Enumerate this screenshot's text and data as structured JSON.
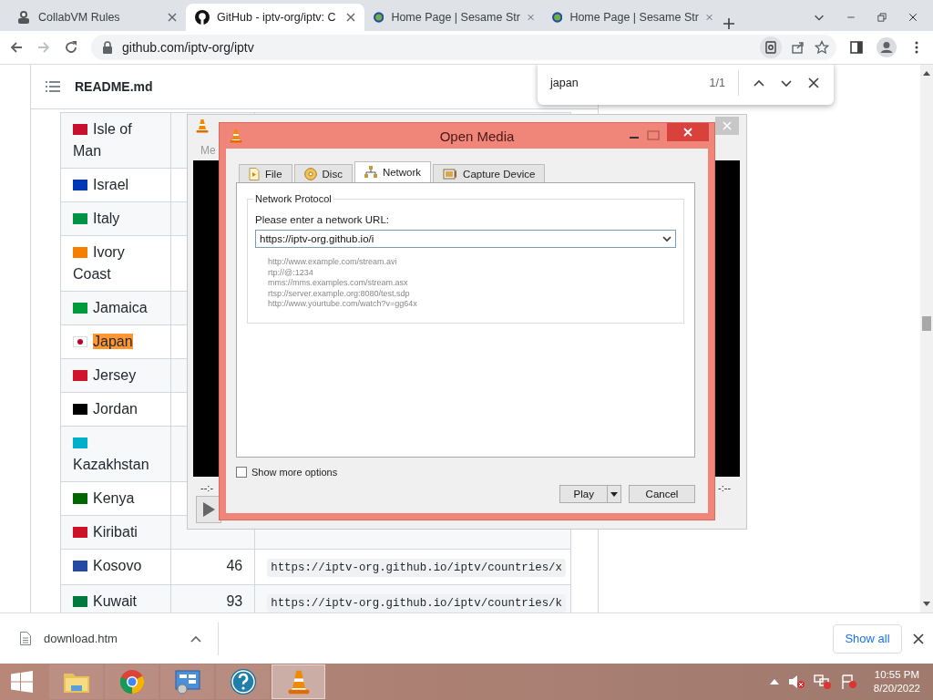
{
  "browser": {
    "tabs": [
      {
        "kind": "collabvm",
        "title": "CollabVM Rules",
        "selected": false
      },
      {
        "kind": "github",
        "title": "GitHub - iptv-org/iptv: C",
        "selected": true
      },
      {
        "kind": "pbs",
        "title": "Home Page | Sesame Str",
        "selected": false
      },
      {
        "kind": "pbs",
        "title": "Home Page | Sesame Str",
        "selected": false
      }
    ],
    "address": "github.com/iptv-org/iptv"
  },
  "find_bar": {
    "query": "japan",
    "count": "1/1"
  },
  "page": {
    "file_title": "README.md",
    "rows": [
      {
        "country": "Isle of Man",
        "color": "#c8102e",
        "match": false
      },
      {
        "country": "Israel",
        "color": "#0038b8",
        "match": false
      },
      {
        "country": "Italy",
        "color": "#009246",
        "match": false
      },
      {
        "country": "Ivory Coast",
        "color": "#f77f00",
        "match": false
      },
      {
        "country": "Jamaica",
        "color": "#009b3a",
        "match": false
      },
      {
        "country": "Japan",
        "color": "#bc002d",
        "match": true
      },
      {
        "country": "Jersey",
        "color": "#cf142b",
        "match": false
      },
      {
        "country": "Jordan",
        "color": "#000000",
        "match": false
      },
      {
        "country": "Kazakhstan",
        "color": "#00afca",
        "match": false
      },
      {
        "country": "Kenya",
        "color": "#006600",
        "match": false
      },
      {
        "country": "Kiribati",
        "color": "#ce1126",
        "match": false
      },
      {
        "country": "Kosovo",
        "color": "#244aa5",
        "match": false,
        "number": "46",
        "url": "https://iptv-org.github.io/iptv/countries/x"
      },
      {
        "country": "Kuwait",
        "color": "#007a3d",
        "match": false,
        "number": "93",
        "url": "https://iptv-org.github.io/iptv/countries/k"
      }
    ]
  },
  "vlc_main": {
    "menu": "Me",
    "time_left": "--:-",
    "time_right": "-:--"
  },
  "dialog": {
    "title": "Open Media",
    "tabs": [
      {
        "kind": "file",
        "label": "File",
        "selected": false
      },
      {
        "kind": "disc",
        "label": "Disc",
        "selected": false
      },
      {
        "kind": "network",
        "label": "Network",
        "selected": true
      },
      {
        "kind": "capture",
        "label": "Capture Device",
        "selected": false
      }
    ],
    "group_title": "Network Protocol",
    "url_label": "Please enter a network URL:",
    "url": "https://iptv-org.github.io/i",
    "examples": [
      "http://www.example.com/stream.avi",
      "rtp://@:1234",
      "mms://mms.examples.com/stream.asx",
      "rtsp://server.example.org:8080/test.sdp",
      "http://www.yourtube.com/watch?v=gg64x"
    ],
    "show_more": {
      "label": "Show more options",
      "checked": false
    },
    "play": "Play",
    "cancel": "Cancel"
  },
  "downloads": {
    "file": "download.htm",
    "show_all": "Show all"
  },
  "taskbar": {
    "apps": [
      {
        "kind": "explorer",
        "selected": false
      },
      {
        "kind": "chrome",
        "selected": false
      },
      {
        "kind": "control-panel",
        "selected": false
      },
      {
        "kind": "help",
        "selected": false
      },
      {
        "kind": "vlc",
        "selected": true
      }
    ],
    "time": "10:55 PM",
    "date": "8/20/2022"
  }
}
